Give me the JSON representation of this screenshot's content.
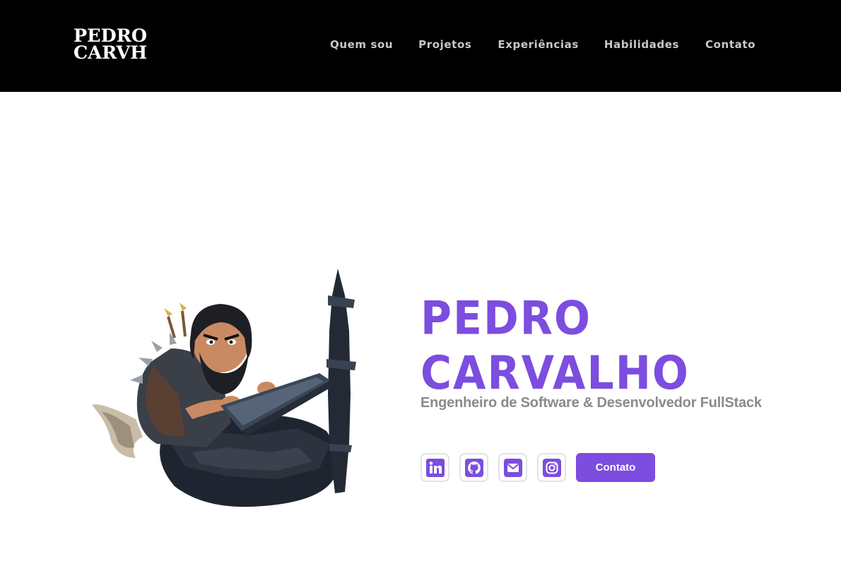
{
  "header": {
    "logo_line1": "PEDRO",
    "logo_line2": "CARVH",
    "nav": [
      {
        "label": "Quem sou"
      },
      {
        "label": "Projetos"
      },
      {
        "label": "Experiências"
      },
      {
        "label": "Habilidades"
      },
      {
        "label": "Contato"
      }
    ]
  },
  "hero": {
    "name_line1": "PEDRO",
    "name_line2": "CARVALHO",
    "subtitle": "Engenheiro de Software & Desenvolvedor FullStack",
    "socials": [
      {
        "icon": "linkedin-icon"
      },
      {
        "icon": "github-icon"
      },
      {
        "icon": "mail-icon"
      },
      {
        "icon": "instagram-icon"
      }
    ],
    "contact_button": "Contato"
  },
  "colors": {
    "accent": "#7c4ddf",
    "nav_bg": "#000000",
    "nav_text": "#c8c8c8",
    "subtitle": "#8a8a8a"
  }
}
